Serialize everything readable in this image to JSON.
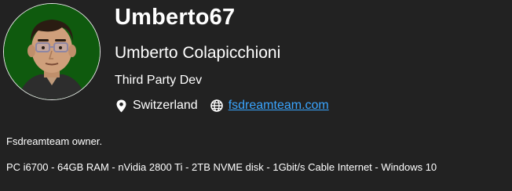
{
  "profile": {
    "username": "Umberto67",
    "full_name": "Umberto Colapicchioni",
    "role": "Third Party Dev",
    "location": "Switzerland",
    "website": "fsdreamteam.com",
    "bio": "Fsdreamteam owner.",
    "specs": "PC i6700 - 64GB RAM - nVidia 2800 Ti - 2TB NVME disk - 1Gbit/s Cable Internet - Windows 10"
  },
  "icons": {
    "location": "map-pin-icon",
    "website": "globe-icon"
  },
  "colors": {
    "background": "#222222",
    "text": "#ffffff",
    "link": "#3aa5ff",
    "avatar_background": "#0f5a0e"
  }
}
